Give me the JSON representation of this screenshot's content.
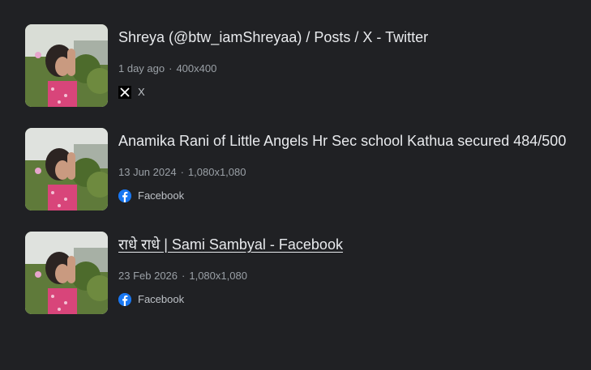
{
  "results": [
    {
      "title": "Shreya (@btw_iamShreyaa) / Posts / X - Twitter",
      "date": "1 day ago",
      "size": "400x400",
      "source": "X",
      "source_icon": "x-logo-icon"
    },
    {
      "title": "Anamika Rani of Little Angels Hr Sec school Kathua secured 484/500",
      "date": "13 Jun 2024",
      "size": "1,080x1,080",
      "source": "Facebook",
      "source_icon": "facebook-logo-icon"
    },
    {
      "title": "राधे राधे | Sami Sambyal - Facebook",
      "date": "23 Feb 2026",
      "size": "1,080x1,080",
      "source": "Facebook",
      "source_icon": "facebook-logo-icon"
    }
  ],
  "separator": "·",
  "colors": {
    "background": "#202124",
    "title": "#e8eaed",
    "meta": "#9aa0a6",
    "facebook": "#1877f2"
  }
}
